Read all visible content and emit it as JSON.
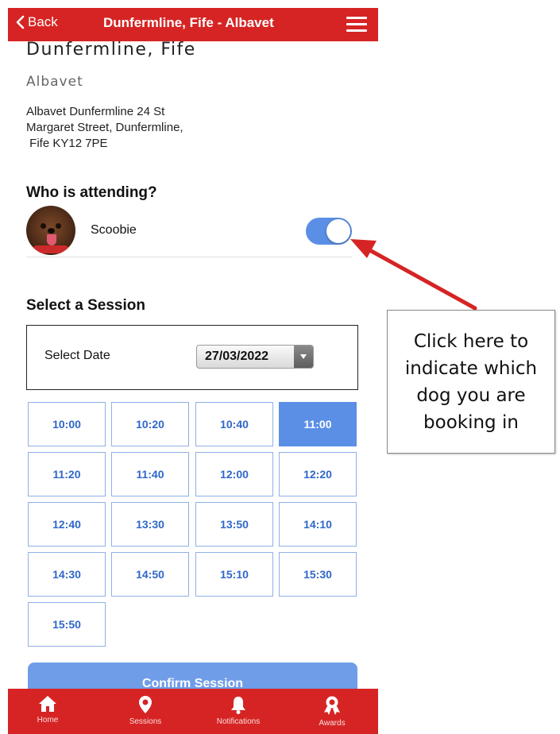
{
  "header": {
    "back_label": "Back",
    "title": "Dunfermline, Fife - Albavet",
    "accent_color": "#d62424"
  },
  "venue": {
    "location": "Dunfermline, Fife",
    "practice": "Albavet",
    "address_lines": [
      "Albavet Dunfermline 24 St",
      "Margaret Street,  Dunfermline,",
      " Fife KY12 7PE"
    ]
  },
  "attending": {
    "heading": "Who is attending?",
    "pets": [
      {
        "name": "Scoobie",
        "selected": true
      }
    ]
  },
  "session": {
    "heading": "Select a Session",
    "date_label": "Select Date",
    "date_value": "27/03/2022",
    "slots": [
      "10:00",
      "10:20",
      "10:40",
      "11:00",
      "11:20",
      "11:40",
      "12:00",
      "12:20",
      "12:40",
      "13:30",
      "13:50",
      "14:10",
      "14:30",
      "14:50",
      "15:10",
      "15:30",
      "15:50"
    ],
    "selected_slot": "11:00",
    "confirm_label": "Confirm Session",
    "highlight_color": "#5b8fe6"
  },
  "bottom_nav": {
    "items": [
      {
        "label": "Home",
        "icon": "home-icon"
      },
      {
        "label": "Sessions",
        "icon": "map-pin-icon"
      },
      {
        "label": "Notifications",
        "icon": "bell-icon"
      },
      {
        "label": "Awards",
        "icon": "award-icon"
      }
    ]
  },
  "annotation": {
    "text_lines": [
      "Click here to",
      "indicate which",
      "dog you are",
      "booking in"
    ],
    "arrow_color": "#d62424"
  }
}
